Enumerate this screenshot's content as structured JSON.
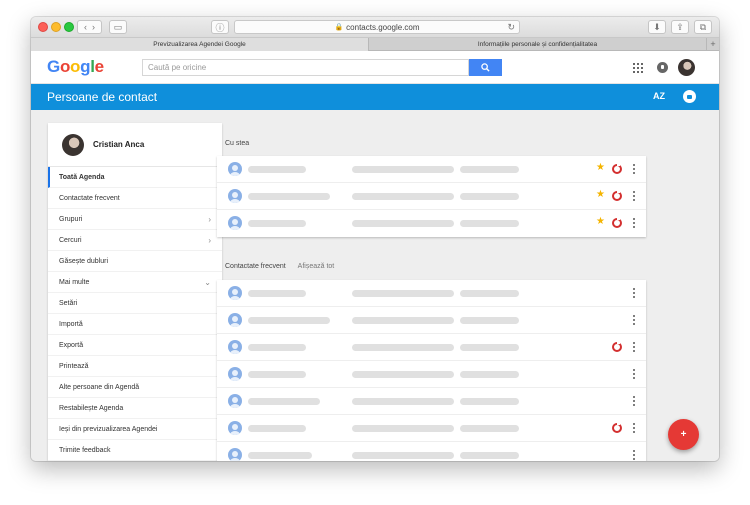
{
  "browser": {
    "url": "contacts.google.com",
    "tabs": [
      {
        "label": "Previzualizarea Agendei Google",
        "active": true
      },
      {
        "label": "Informațiile personale și confidențialitatea",
        "active": false
      }
    ]
  },
  "header": {
    "logo": "Google",
    "search_placeholder": "Caută pe oricine"
  },
  "bluebar": {
    "title": "Persoane de contact",
    "sort_icon_text": "AZ"
  },
  "sidebar": {
    "user_name": "Cristian Anca",
    "items": [
      {
        "label": "Toată Agenda",
        "active": true,
        "chevron": ""
      },
      {
        "label": "Contactate frecvent",
        "active": false,
        "chevron": ""
      },
      {
        "label": "Grupuri",
        "active": false,
        "chevron": "›"
      },
      {
        "label": "Cercuri",
        "active": false,
        "chevron": "›"
      },
      {
        "label": "Găsește dubluri",
        "active": false,
        "chevron": ""
      },
      {
        "label": "Mai multe",
        "active": false,
        "chevron": "⌄"
      },
      {
        "label": "Setări",
        "active": false,
        "chevron": ""
      },
      {
        "label": "Importă",
        "active": false,
        "chevron": ""
      },
      {
        "label": "Exportă",
        "active": false,
        "chevron": ""
      },
      {
        "label": "Printează",
        "active": false,
        "chevron": ""
      },
      {
        "label": "Alte persoane din Agendă",
        "active": false,
        "chevron": ""
      },
      {
        "label": "Restabilește Agenda",
        "active": false,
        "chevron": ""
      },
      {
        "label": "Ieși din previzualizarea Agendei",
        "active": false,
        "chevron": ""
      },
      {
        "label": "Trimite feedback",
        "active": false,
        "chevron": ""
      }
    ]
  },
  "starred": {
    "label": "Cu stea",
    "rows": [
      {
        "starred": true,
        "google": true
      },
      {
        "starred": true,
        "google": true
      },
      {
        "starred": true,
        "google": true
      }
    ]
  },
  "frequent": {
    "label": "Contactate frecvent",
    "link": "Afișează tot",
    "rows": [
      {
        "starred": false,
        "google": false
      },
      {
        "starred": false,
        "google": false
      },
      {
        "starred": false,
        "google": true
      },
      {
        "starred": false,
        "google": false
      },
      {
        "starred": false,
        "google": false
      },
      {
        "starred": false,
        "google": true
      },
      {
        "starred": false,
        "google": false
      }
    ]
  },
  "icons": {
    "star": "★",
    "fab": "+",
    "star_color": "#f4b400",
    "accent": "#0f8fdb",
    "fab_color": "#e53935"
  }
}
